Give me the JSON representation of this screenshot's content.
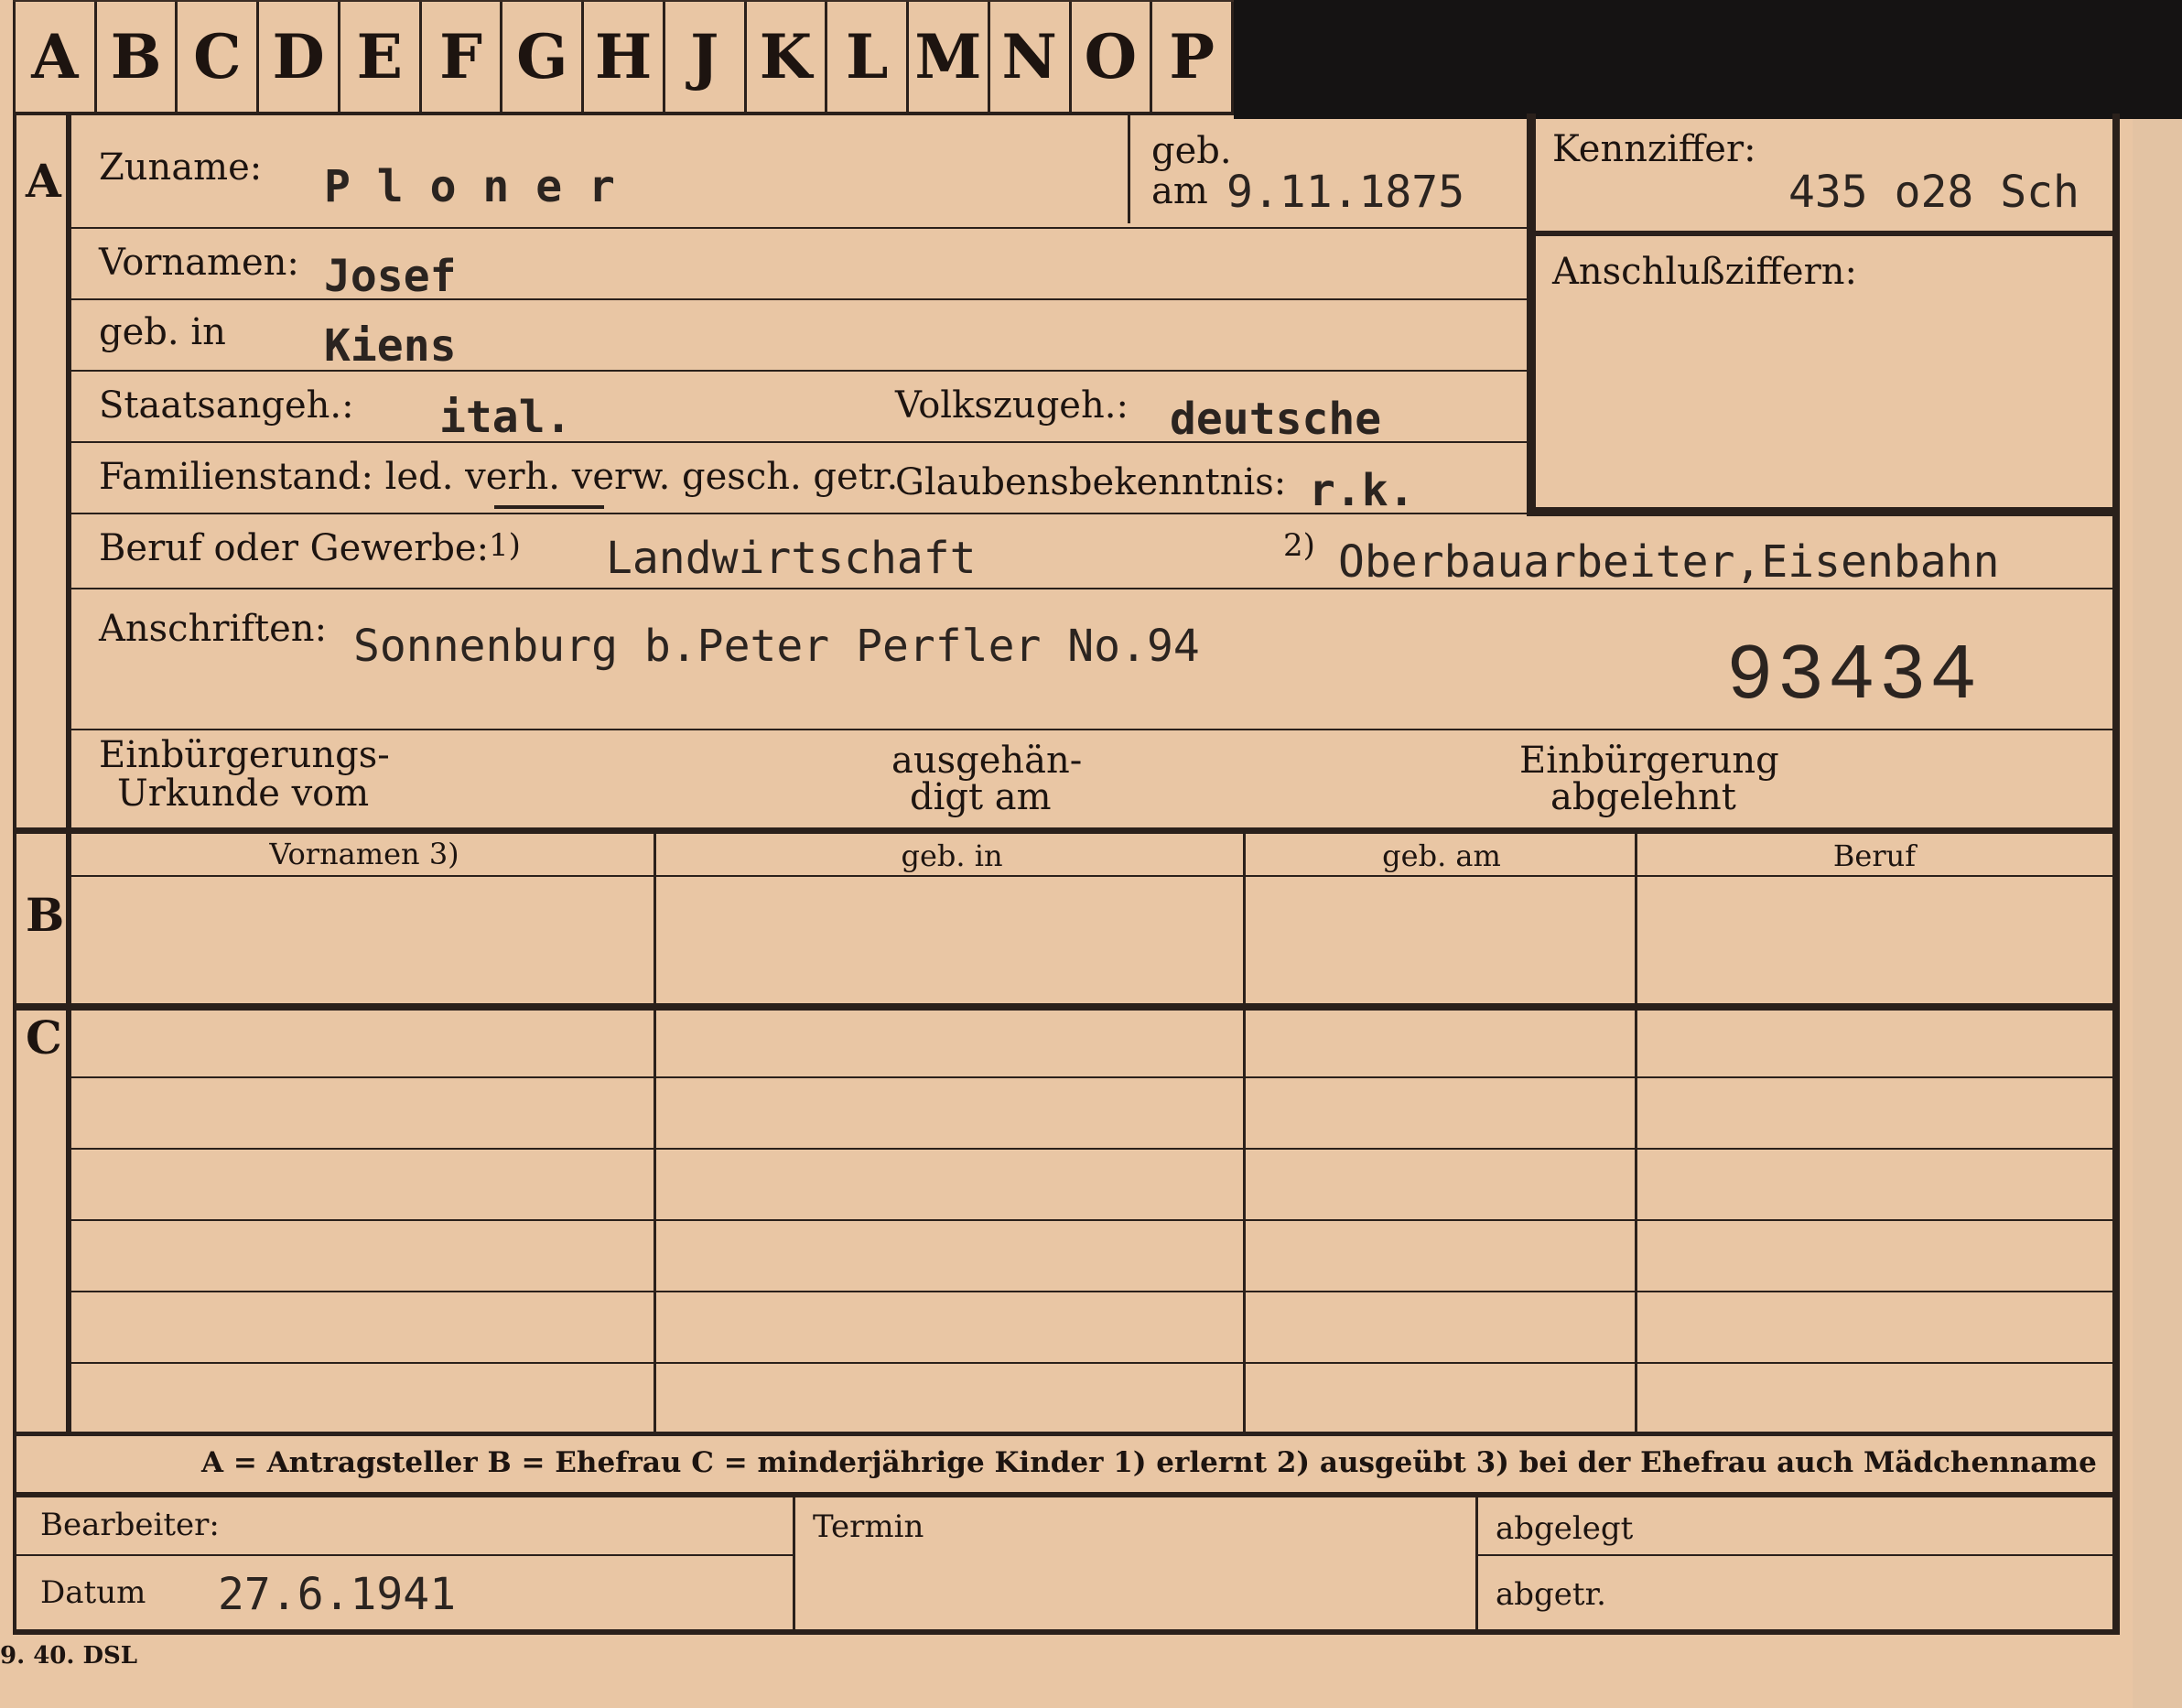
{
  "tabs": [
    "A",
    "B",
    "C",
    "D",
    "E",
    "F",
    "G",
    "H",
    "J",
    "K",
    "L",
    "M",
    "N",
    "O",
    "P"
  ],
  "sections": {
    "a": "A",
    "b": "B",
    "c": "C"
  },
  "labels": {
    "zuname": "Zuname:",
    "geb": "geb.",
    "am": "am",
    "kennziffer": "Kennziffer:",
    "anschlussziffern": "Anschlußziffern:",
    "vornamen": "Vornamen:",
    "geb_in": "geb. in",
    "staatsangeh": "Staatsangeh.:",
    "volkszugeh": "Volkszugeh.:",
    "familienstand": "Familienstand: led. verh. verw. gesch. getr.",
    "glaubensbekenntnis": "Glaubensbekenntnis:",
    "beruf": "Beruf oder Gewerbe:",
    "note1": "1)",
    "note2": "2)",
    "anschriften": "Anschriften:",
    "einb_urkunde_1": "Einbürgerungs-",
    "einb_urkunde_2": "Urkunde vom",
    "ausgehaendigt_1": "ausgehän-",
    "ausgehaendigt_2": "digt am",
    "einb_abgelehnt_1": "Einbürgerung",
    "einb_abgelehnt_2": "abgelehnt",
    "bearbeiter": "Bearbeiter:",
    "datum": "Datum",
    "termin": "Termin",
    "abgelegt": "abgelegt",
    "abgetr": "abgetr."
  },
  "values": {
    "zuname": "P l o n e r",
    "geb_am": "9.11.1875",
    "kennziffer": "435 o28  Sch",
    "vornamen": "Josef",
    "geb_in": "Kiens",
    "staatsangeh": "ital.",
    "volkszugeh": "deutsche",
    "glaubensbekenntnis": "r.k.",
    "beruf_erlernt": "Landwirtschaft",
    "beruf_ausgeuebt": "Oberbauarbeiter,Eisenbahn",
    "anschriften": "Sonnenburg b.Peter Perfler No.94",
    "stamp_number": "93434",
    "datum": "27.6.1941"
  },
  "table": {
    "headers": [
      "Vornamen 3)",
      "geb. in",
      "geb. am",
      "Beruf"
    ]
  },
  "legend": "A = Antragsteller   B = Ehefrau   C = minderjährige Kinder   1) erlernt   2) ausgeübt   3) bei der Ehefrau auch Mädchenname",
  "footer_code": "9. 40. DSL"
}
